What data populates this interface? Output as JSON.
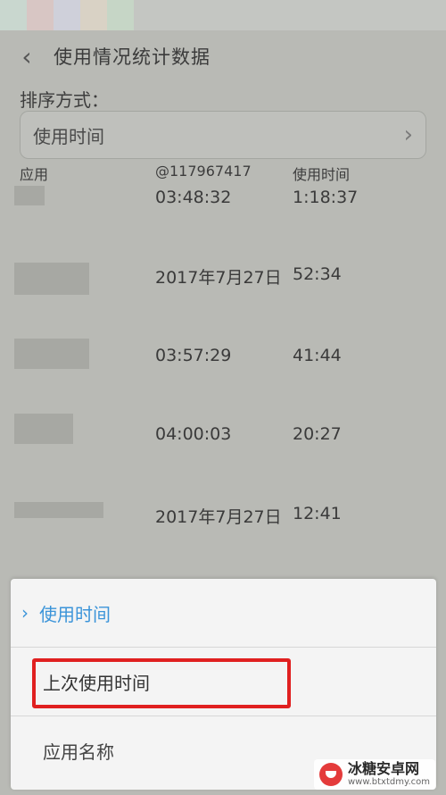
{
  "colors": {
    "accent": "#3b94d9",
    "highlight": "#e02020",
    "dim_overlay": "#b9bab5",
    "sheet": "#f4f4f4"
  },
  "status_bar": {
    "blocks": [
      "#c9d7cf",
      "#d8c6c4",
      "#cfd0da",
      "#d9d2c5",
      "#c6d6c6"
    ]
  },
  "app_bar": {
    "back_icon": "chevron-left-icon",
    "title": "使用情况统计数据"
  },
  "sort": {
    "label": "排序方式：",
    "value": "使用时间",
    "chevron_icon": "chevron-right-icon"
  },
  "table": {
    "headers": [
      "应用",
      "@117967417",
      "使用时间"
    ],
    "rows": [
      {
        "last_used": "03:48:32",
        "duration": "1:18:37"
      },
      {
        "last_used": "2017年7月27日",
        "duration": "52:34"
      },
      {
        "last_used": "03:57:29",
        "duration": "41:44"
      },
      {
        "last_used": "04:00:03",
        "duration": "20:27"
      },
      {
        "last_used": "2017年7月27日",
        "duration": "12:41"
      }
    ]
  },
  "sheet": {
    "options": [
      {
        "label": "使用时间",
        "selected": true,
        "icon": "chevron-right-icon"
      },
      {
        "label": "上次使用时间",
        "selected": false
      },
      {
        "label": "应用名称",
        "selected": false
      }
    ]
  },
  "watermark": {
    "title": "冰糖安卓网",
    "url": "www.btxtdmy.com"
  }
}
